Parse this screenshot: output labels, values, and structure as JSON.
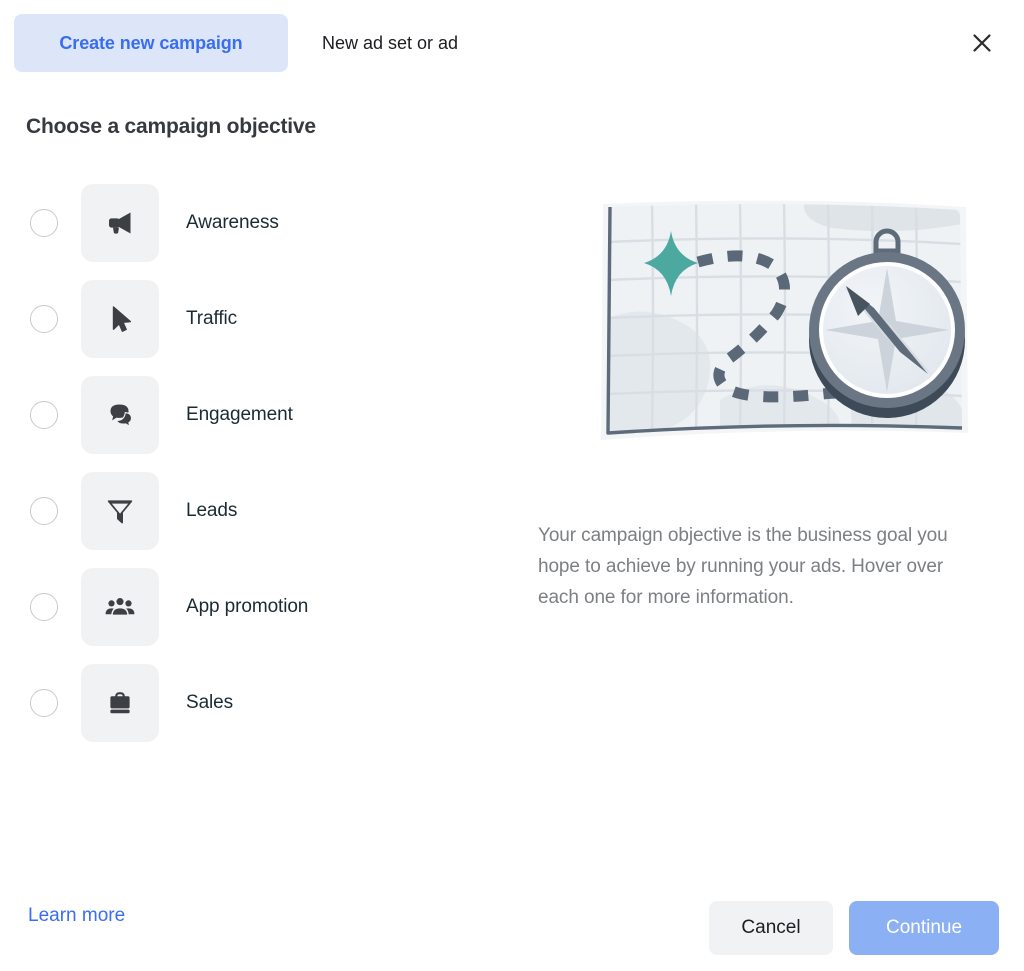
{
  "header": {
    "tab_create_campaign": "Create new campaign",
    "tab_new_adset": "New ad set or ad",
    "close_icon": "close-icon"
  },
  "main": {
    "heading": "Choose a campaign objective",
    "objectives": [
      {
        "label": "Awareness",
        "icon": "megaphone-icon",
        "selected": false
      },
      {
        "label": "Traffic",
        "icon": "cursor-icon",
        "selected": false
      },
      {
        "label": "Engagement",
        "icon": "chat-bubbles-icon",
        "selected": false
      },
      {
        "label": "Leads",
        "icon": "funnel-icon",
        "selected": false
      },
      {
        "label": "App promotion",
        "icon": "people-group-icon",
        "selected": false
      },
      {
        "label": "Sales",
        "icon": "briefcase-icon",
        "selected": false
      }
    ]
  },
  "right_panel": {
    "illustration": "map-with-compass-illustration",
    "description": "Your campaign objective is the business goal you hope to achieve by running your ads. Hover over each one for more information."
  },
  "footer": {
    "learn_more": "Learn more",
    "cancel": "Cancel",
    "continue": "Continue",
    "continue_disabled": true
  },
  "colors": {
    "accent_blue": "#3a6ef0",
    "tab_active_bg": "#dde6f9",
    "continue_disabled_bg": "#8cb0f4",
    "icon_tile_bg": "#f1f2f3",
    "map_paper": "#eef2f5",
    "map_grid": "#d8dee4",
    "map_border": "#5e6b7a",
    "path_dash": "#5b6877",
    "star_teal": "#4ba9a0",
    "compass_rim": "#6b7684",
    "compass_shadow": "#3e4a57",
    "text_primary": "#1c2b33",
    "text_muted": "#7c7f83"
  }
}
